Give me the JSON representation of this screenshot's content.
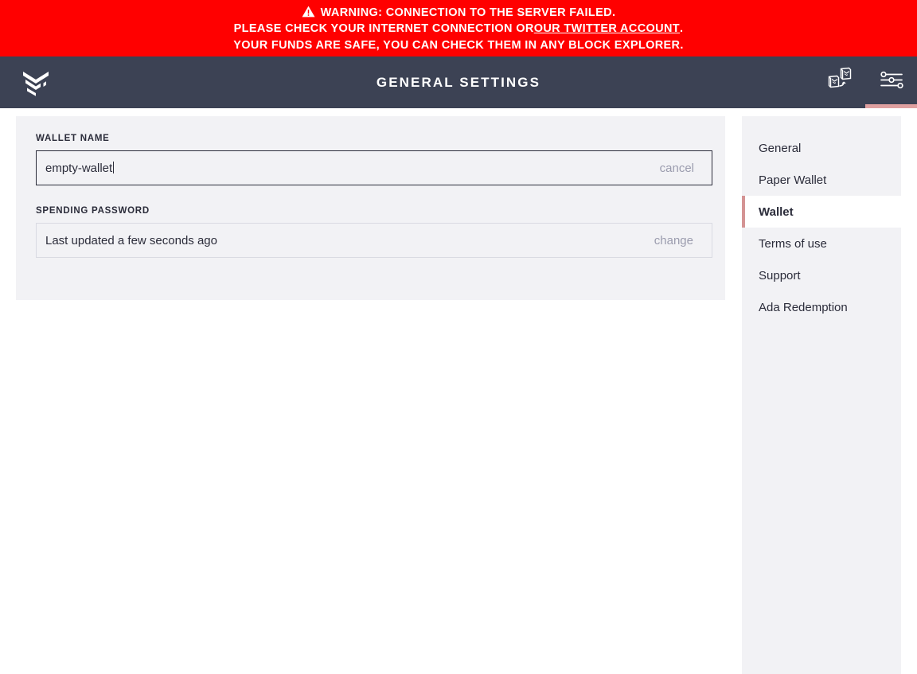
{
  "warning": {
    "icon": "warning-triangle-icon",
    "line1": "WARNING: CONNECTION TO THE SERVER FAILED.",
    "line2_before": "PLEASE CHECK YOUR INTERNET CONNECTION OR ",
    "line2_link": "OUR TWITTER ACCOUNT",
    "line2_after": ".",
    "line3": "YOUR FUNDS ARE SAFE, YOU CAN CHECK THEM IN ANY BLOCK EXPLORER.",
    "background_color": "#ff0000",
    "text_color": "#ffffff"
  },
  "topbar": {
    "logo_icon": "daedalus-logo-icon",
    "title": "GENERAL SETTINGS",
    "background_color": "#3c4254",
    "actions": [
      {
        "name": "wallet-switch-icon",
        "label": "",
        "active": false
      },
      {
        "name": "settings-sliders-icon",
        "label": "",
        "active": true
      }
    ],
    "active_indicator_color": "#dfa0a0"
  },
  "main": {
    "wallet_name": {
      "label": "WALLET NAME",
      "value": "empty-wallet",
      "placeholder": "Wallet name",
      "action_label": "cancel",
      "editing": true
    },
    "spending_password": {
      "label": "SPENDING PASSWORD",
      "value": "Last updated a few seconds ago",
      "action_label": "change",
      "editing": false
    },
    "card_background": "#f2f2f5"
  },
  "settings_menu": {
    "background": "#f2f2f5",
    "active_marker_color": "#d49494",
    "items": [
      {
        "label": "General",
        "active": false
      },
      {
        "label": "Paper Wallet",
        "active": false
      },
      {
        "label": "Wallet",
        "active": true
      },
      {
        "label": "Terms of use",
        "active": false
      },
      {
        "label": "Support",
        "active": false
      },
      {
        "label": "Ada Redemption",
        "active": false
      }
    ]
  }
}
